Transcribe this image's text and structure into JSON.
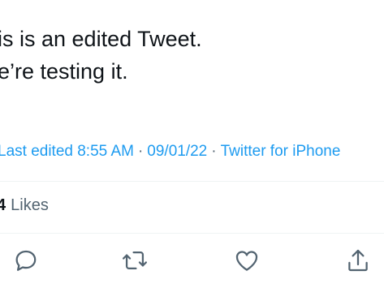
{
  "tweet": {
    "line1": "is is an edited Tweet.",
    "line2": "e’re testing it."
  },
  "meta": {
    "last_edited": "Last edited 8:55 AM",
    "date": "09/01/22",
    "source": "Twitter for iPhone",
    "separator": "·"
  },
  "stats": {
    "likes_count": "4",
    "likes_label": "Likes"
  },
  "actions": {
    "icons": [
      "reply-icon",
      "retweet-icon",
      "like-icon",
      "share-icon"
    ]
  },
  "colors": {
    "link": "#1d9bf0",
    "secondary_text": "#536471",
    "icon": "#536471",
    "divider": "#eff3f4"
  }
}
